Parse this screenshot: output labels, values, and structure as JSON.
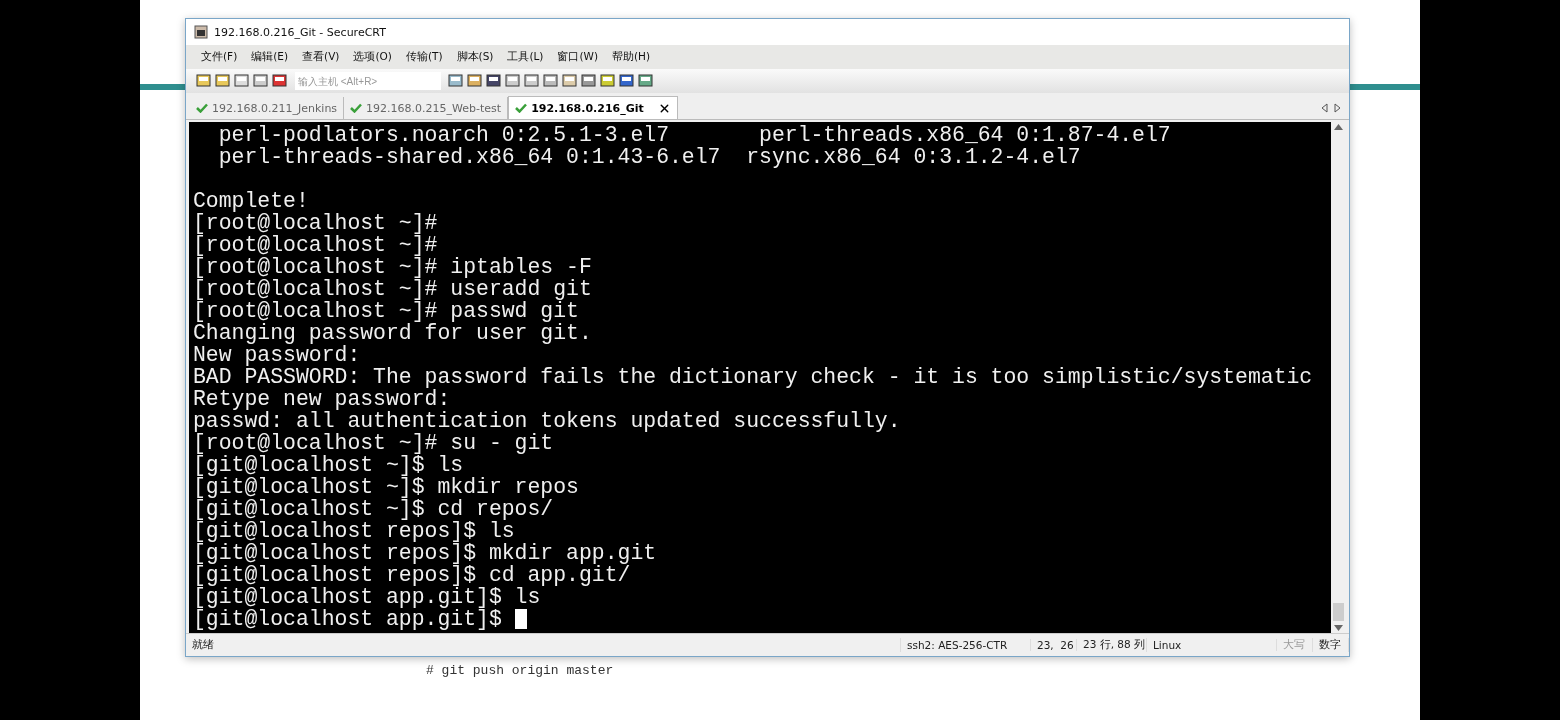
{
  "window": {
    "title": "192.168.0.216_Git - SecureCRT"
  },
  "menu": [
    "文件(F)",
    "编辑(E)",
    "查看(V)",
    "选项(O)",
    "传输(T)",
    "脚本(S)",
    "工具(L)",
    "窗口(W)",
    "帮助(H)"
  ],
  "toolbar": {
    "host_field": {
      "placeholder": "输入主机 <Alt+R>"
    }
  },
  "tabs": [
    {
      "label": "192.168.0.211_Jenkins",
      "selected": false
    },
    {
      "label": "192.168.0.215_Web-test",
      "selected": false
    },
    {
      "label": "192.168.0.216_Git",
      "selected": true
    }
  ],
  "terminal": {
    "blocks": [
      [
        "  perl-podlators.noarch 0:2.5.1-3.el7       perl-threads.x86_64 0:1.87-4.el7",
        "  perl-threads-shared.x86_64 0:1.43-6.el7  rsync.x86_64 0:3.1.2-4.el7"
      ],
      [
        "Complete!",
        "[root@localhost ~]#",
        "[root@localhost ~]#",
        "[root@localhost ~]# iptables -F",
        "[root@localhost ~]# useradd git",
        "[root@localhost ~]# passwd git",
        "Changing password for user git.",
        "New password:",
        "BAD PASSWORD: The password fails the dictionary check - it is too simplistic/systematic",
        "Retype new password:",
        "passwd: all authentication tokens updated successfully.",
        "[root@localhost ~]# su - git",
        "[git@localhost ~]$ ls",
        "[git@localhost ~]$ mkdir repos",
        "[git@localhost ~]$ cd repos/",
        "[git@localhost repos]$ ls",
        "[git@localhost repos]$ mkdir app.git",
        "[git@localhost repos]$ cd app.git/",
        "[git@localhost app.git]$ ls",
        "[git@localhost app.git]$ "
      ]
    ]
  },
  "status_bar": {
    "status": "就绪",
    "cipher": "ssh2: AES-256-CTR",
    "position": "23,  26",
    "size": "23 行, 88 列",
    "os": "Linux",
    "indicators": [
      {
        "label": "大写",
        "on": false
      },
      {
        "label": "数字",
        "on": true
      }
    ]
  },
  "slide_text": "# git push origin master"
}
